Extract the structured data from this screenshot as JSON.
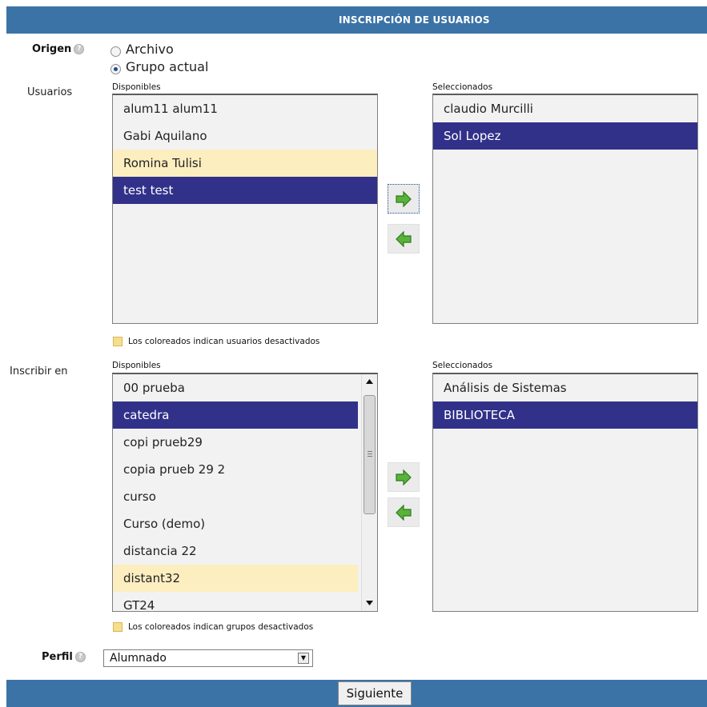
{
  "header": {
    "title": "INSCRIPCIÓN DE USUARIOS"
  },
  "origen": {
    "label": "Origen",
    "options": [
      "Archivo",
      "Grupo actual"
    ],
    "selected_index": 1
  },
  "usuarios": {
    "label": "Usuarios",
    "available_label": "Disponibles",
    "selected_label": "Seleccionados",
    "available": [
      "alum11 alum11",
      "Gabi Aquilano",
      "Romina Tulisi",
      "test test"
    ],
    "selected": [
      "claudio Murcilli",
      "Sol Lopez"
    ],
    "legend": "Los coloreados indican usuarios desactivados"
  },
  "inscribir": {
    "label": "Inscribir en",
    "available_label": "Disponibles",
    "selected_label": "Seleccionados",
    "available": [
      "00 prueba",
      "catedra",
      "copi prueb29",
      "copia prueb 29 2",
      "curso",
      "Curso (demo)",
      "distancia 22",
      "distant32",
      "GT24"
    ],
    "selected": [
      "Análisis de Sistemas",
      "BIBLIOTECA"
    ],
    "legend": "Los coloreados indican grupos desactivados"
  },
  "perfil": {
    "label": "Perfil",
    "value": "Alumnado"
  },
  "footer": {
    "next_label": "Siguiente"
  },
  "colors": {
    "header_bg": "#3b73a6",
    "selected_bg": "#31318a",
    "deactivated_bg": "#fdeec0"
  }
}
